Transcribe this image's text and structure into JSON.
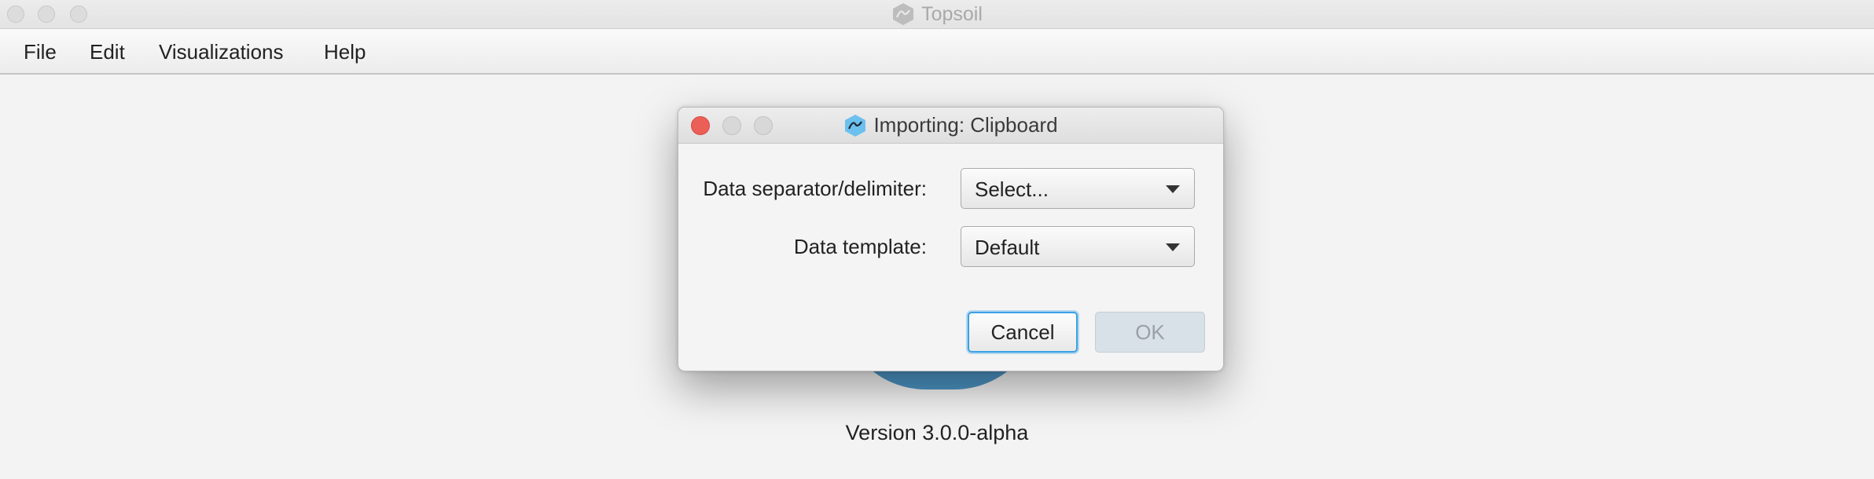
{
  "window": {
    "title": "Topsoil",
    "app_icon": "topsoil-hex-icon"
  },
  "menubar": {
    "items": [
      "File",
      "Edit",
      "Visualizations",
      "Help"
    ]
  },
  "background": {
    "version_text": "Version 3.0.0-alpha",
    "logo_color": "#4b93c2"
  },
  "dialog": {
    "title": "Importing: Clipboard",
    "title_icon": "topsoil-hex-icon",
    "fields": [
      {
        "label": "Data separator/delimiter:",
        "value": "Select..."
      },
      {
        "label": "Data template:",
        "value": "Default"
      }
    ],
    "buttons": {
      "cancel": "Cancel",
      "ok": "OK"
    },
    "ok_enabled": false
  },
  "colors": {
    "close_button": "#ec5f57",
    "focus_ring": "#3aa0e6",
    "disabled_button": "#d8e1e8"
  }
}
